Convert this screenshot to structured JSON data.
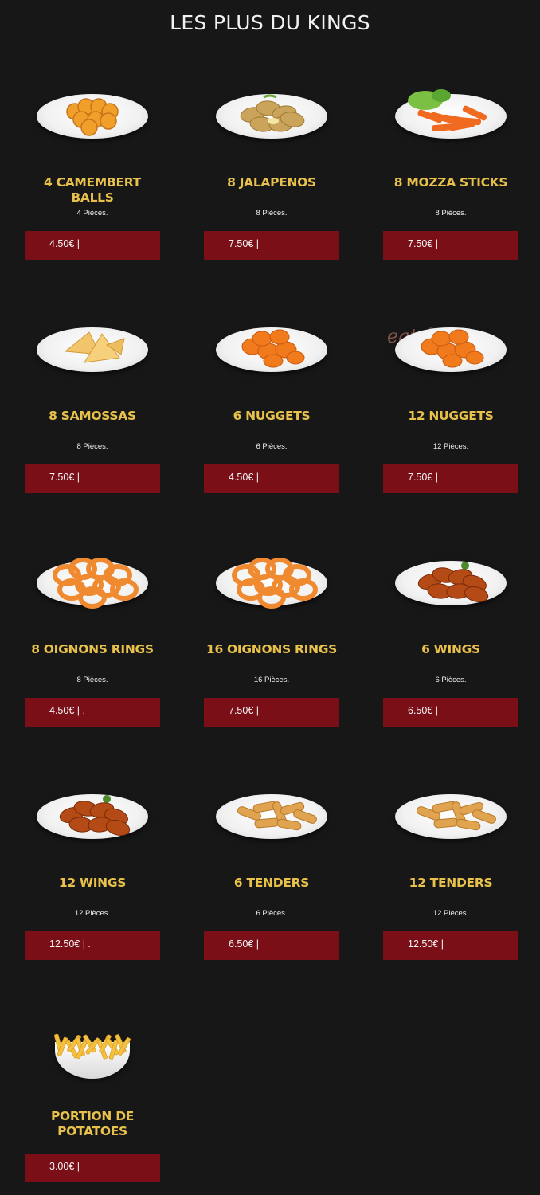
{
  "page": {
    "title": "LES PLUS DU KINGS"
  },
  "watermark": "eatsbs.fr",
  "items": [
    {
      "name": "4 CAMEMBERT BALLS",
      "pieces": "4 Pièces.",
      "price": "4.50€ |",
      "food": "balls"
    },
    {
      "name": "8 JALAPENOS",
      "pieces": "8 Pièces.",
      "price": "7.50€ |",
      "food": "jalapenos"
    },
    {
      "name": "8 MOZZA STICKS",
      "pieces": "8 Pièces.",
      "price": "7.50€ |",
      "food": "sticks"
    },
    {
      "name": "8 SAMOSSAS",
      "pieces": "8 Pièces.",
      "price": "7.50€ |",
      "food": "samosas"
    },
    {
      "name": "6 NUGGETS",
      "pieces": "6 Pièces.",
      "price": "4.50€ |",
      "food": "nuggets"
    },
    {
      "name": "12 NUGGETS",
      "pieces": "12 Pièces.",
      "price": "7.50€ |",
      "food": "nuggets"
    },
    {
      "name": "8 OIGNONS RINGS",
      "pieces": "8 Pièces.",
      "price": "4.50€ | .",
      "food": "rings"
    },
    {
      "name": "16 OIGNONS RINGS",
      "pieces": "16 Pièces.",
      "price": "7.50€ |",
      "food": "rings"
    },
    {
      "name": "6 WINGS",
      "pieces": "6 Pièces.",
      "price": "6.50€ |",
      "food": "wings"
    },
    {
      "name": "12 WINGS",
      "pieces": "12 Pièces.",
      "price": "12.50€ | .",
      "food": "wings"
    },
    {
      "name": "6 TENDERS",
      "pieces": "6 Pièces.",
      "price": "6.50€ |",
      "food": "tenders"
    },
    {
      "name": "12 TENDERS",
      "pieces": "12 Pièces.",
      "price": "12.50€ |",
      "food": "tenders"
    },
    {
      "name": "PORTION DE POTATOES",
      "pieces": "",
      "price": "3.00€ |",
      "food": "fries"
    }
  ]
}
